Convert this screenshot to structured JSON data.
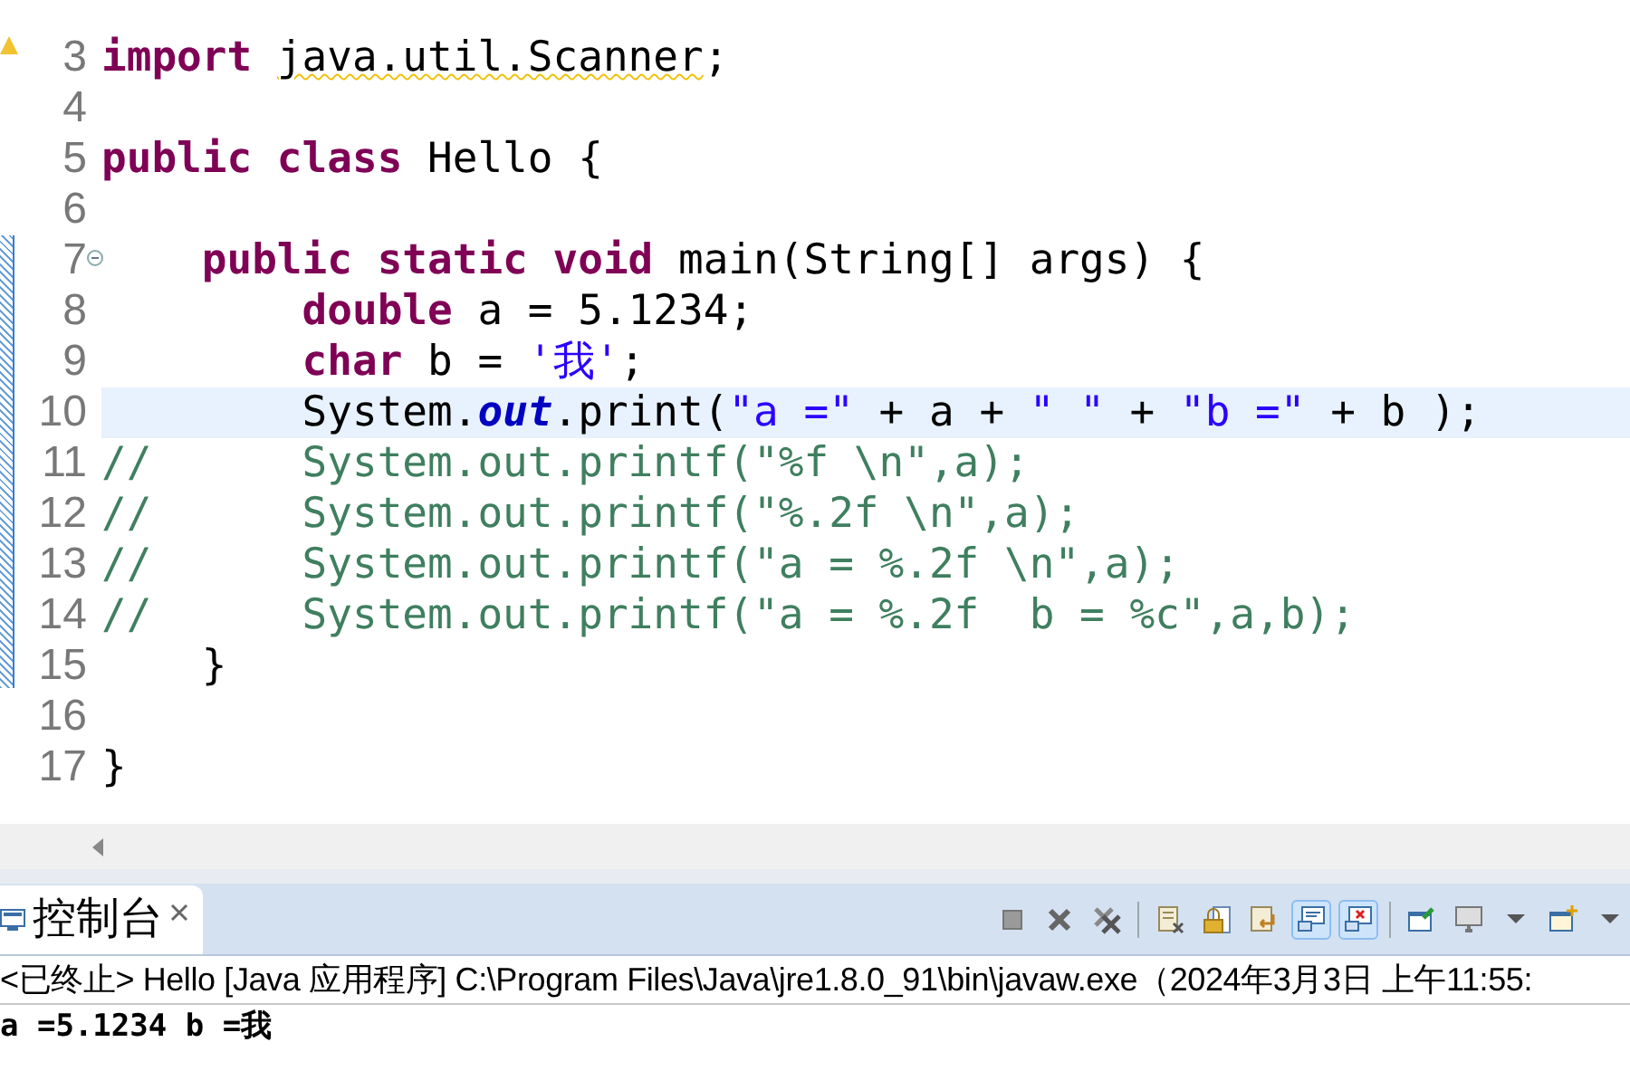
{
  "editor": {
    "lines": [
      {
        "number": "3",
        "warning": true,
        "tokens": [
          {
            "kind": "keyword",
            "text": "import "
          },
          {
            "kind": "plain",
            "text": "java.util.Scanner",
            "warning": true
          },
          {
            "kind": "plain",
            "text": ";"
          }
        ]
      },
      {
        "number": "4"
      },
      {
        "number": "5",
        "tokens": [
          {
            "kind": "keyword",
            "text": "public class"
          },
          {
            "kind": "plain",
            "text": " Hello {"
          }
        ]
      },
      {
        "number": "6"
      },
      {
        "number": "7",
        "fold": true,
        "expanded": true,
        "tokens": [
          {
            "kind": "keyword",
            "text": "    public static void"
          },
          {
            "kind": "plain",
            "text": " main(String[] args) {"
          }
        ]
      },
      {
        "number": "8",
        "tokens": [
          {
            "kind": "keyword",
            "text": "        double"
          },
          {
            "kind": "plain",
            "text": " a = 5.1234;"
          }
        ]
      },
      {
        "number": "9",
        "tokens": [
          {
            "kind": "keyword",
            "text": "        char"
          },
          {
            "kind": "plain",
            "text": " b = "
          },
          {
            "kind": "string",
            "text": "'我'"
          },
          {
            "kind": "plain",
            "text": ";"
          }
        ]
      },
      {
        "number": "10",
        "current": true,
        "tokens": [
          {
            "kind": "plain",
            "text": "        System."
          },
          {
            "kind": "field",
            "text": "out"
          },
          {
            "kind": "plain",
            "text": ".print("
          },
          {
            "kind": "string",
            "text": "\"a =\""
          },
          {
            "kind": "plain",
            "text": " + a + "
          },
          {
            "kind": "string",
            "text": "\" \""
          },
          {
            "kind": "plain",
            "text": " + "
          },
          {
            "kind": "string",
            "text": "\"b =\""
          },
          {
            "kind": "plain",
            "text": " + b );"
          }
        ]
      },
      {
        "number": "11",
        "tokens": [
          {
            "kind": "comment",
            "text": "//      System.out.printf(\"%f \\n\",a);"
          }
        ]
      },
      {
        "number": "12",
        "tokens": [
          {
            "kind": "comment",
            "text": "//      System.out.printf(\"%.2f \\n\",a);"
          }
        ]
      },
      {
        "number": "13",
        "tokens": [
          {
            "kind": "comment",
            "text": "//      System.out.printf(\"a = %.2f \\n\",a);"
          }
        ]
      },
      {
        "number": "14",
        "tokens": [
          {
            "kind": "comment",
            "text": "//      System.out.printf(\"a = %.2f  b = %c\",a,b);"
          }
        ]
      },
      {
        "number": "15",
        "tokens": [
          {
            "kind": "plain",
            "text": "    }"
          }
        ]
      },
      {
        "number": "16"
      },
      {
        "number": "17",
        "tokens": [
          {
            "kind": "plain",
            "text": "}"
          }
        ]
      }
    ]
  },
  "console": {
    "tab": {
      "label": "控制台",
      "selected": true
    },
    "toolbar": [
      {
        "kind": "stop",
        "pressed": false
      },
      {
        "kind": "remove",
        "pressed": false
      },
      {
        "kind": "remove-all",
        "pressed": false
      },
      {
        "kind": "sep"
      },
      {
        "kind": "clear",
        "pressed": false
      },
      {
        "kind": "lock",
        "pressed": false
      },
      {
        "kind": "wrap",
        "pressed": false
      },
      {
        "kind": "show-out",
        "pressed": true
      },
      {
        "kind": "show-err",
        "pressed": true
      },
      {
        "kind": "sep"
      },
      {
        "kind": "pin",
        "pressed": false
      },
      {
        "kind": "display",
        "pressed": false
      },
      {
        "kind": "dropdown"
      },
      {
        "kind": "new",
        "pressed": false
      },
      {
        "kind": "dropdown"
      }
    ],
    "status": "<已终止> Hello [Java 应用程序] C:\\Program Files\\Java\\jre1.8.0_91\\bin\\javaw.exe（2024年3月3日 上午11:55:",
    "output": [
      "a =5.1234 b =我"
    ]
  }
}
